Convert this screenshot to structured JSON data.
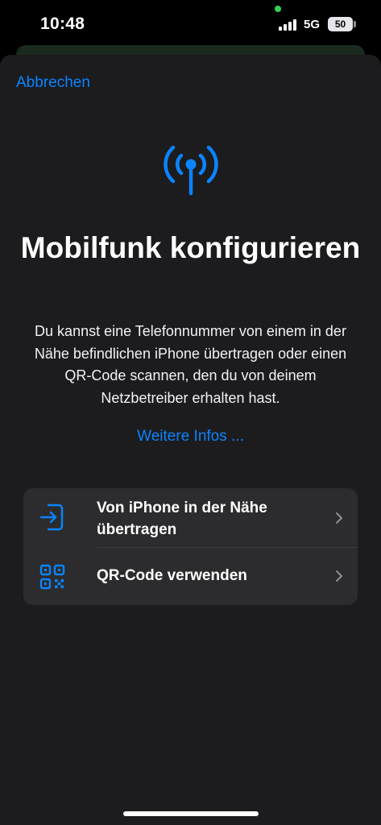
{
  "status_bar": {
    "time": "10:48",
    "network": "5G",
    "battery": "50",
    "indicator_color": "#30d158"
  },
  "header": {
    "cancel_label": "Abbrechen"
  },
  "hero": {
    "icon": "antenna-radiowaves-icon",
    "title": "Mobilfunk konfigurieren",
    "description": "Du kannst eine Telefonnummer von einem in der Nähe befindlichen iPhone übertragen oder einen QR-Code scannen, den du von deinem Netzbetreiber erhalten hast.",
    "more_link": "Weitere Infos ..."
  },
  "options": [
    {
      "icon": "transfer-in-icon",
      "label": "Von iPhone in der Nähe übertragen"
    },
    {
      "icon": "qr-code-icon",
      "label": "QR-Code verwenden"
    }
  ],
  "colors": {
    "accent": "#0a84ff",
    "sheet_background": "#1c1c1e",
    "card_background": "#2c2c2e"
  }
}
